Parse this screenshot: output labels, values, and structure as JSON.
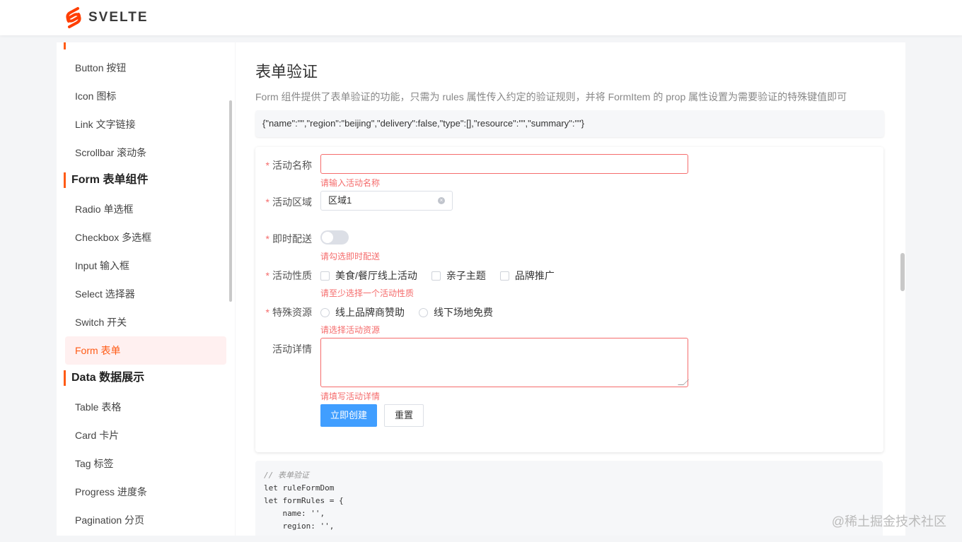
{
  "header": {
    "brand": "SVELTE"
  },
  "sidebar": {
    "groups": {
      "form": "Form 表单组件",
      "data": "Data 数据展示"
    },
    "items": {
      "button": "Button 按钮",
      "icon": "Icon 图标",
      "link": "Link 文字链接",
      "scrollbar": "Scrollbar 滚动条",
      "radio": "Radio 单选框",
      "checkbox": "Checkbox 多选框",
      "input": "Input 输入框",
      "select": "Select 选择器",
      "switch": "Switch 开关",
      "form": "Form 表单",
      "table": "Table 表格",
      "card": "Card 卡片",
      "tag": "Tag 标签",
      "progress": "Progress 进度条",
      "pagination": "Pagination 分页"
    },
    "active": "form"
  },
  "main": {
    "title": "表单验证",
    "desc": "Form 组件提供了表单验证的功能，只需为 rules 属性传入约定的验证规则，并将 FormItem 的 prop 属性设置为需要验证的特殊键值即可",
    "json_preview": "{\"name\":\"\",\"region\":\"beijing\",\"delivery\":false,\"type\":[],\"resource\":\"\",\"summary\":\"\"}"
  },
  "form": {
    "required_mark": "*",
    "name": {
      "label": "活动名称",
      "value": "",
      "error": "请输入活动名称"
    },
    "region": {
      "label": "活动区域",
      "value": "区域1"
    },
    "delivery": {
      "label": "即时配送",
      "checked": false,
      "error": "请勾选即时配送"
    },
    "type": {
      "label": "活动性质",
      "options": [
        "美食/餐厅线上活动",
        "亲子主题",
        "品牌推广"
      ],
      "error": "请至少选择一个活动性质"
    },
    "resource": {
      "label": "特殊资源",
      "options": [
        "线上品牌商赞助",
        "线下场地免费"
      ],
      "error": "请选择活动资源"
    },
    "summary": {
      "label": "活动详情",
      "value": "",
      "error": "请填写活动详情"
    },
    "submit": "立即创建",
    "reset": "重置"
  },
  "code": {
    "lines": [
      "// 表单验证",
      "let ruleFormDom",
      "let formRules = {",
      "    name: '',",
      "    region: '',"
    ]
  },
  "watermark": "@稀土掘金技术社区",
  "colors": {
    "accent": "#ff5b16",
    "primary": "#409eff",
    "error": "#f56c6c"
  }
}
